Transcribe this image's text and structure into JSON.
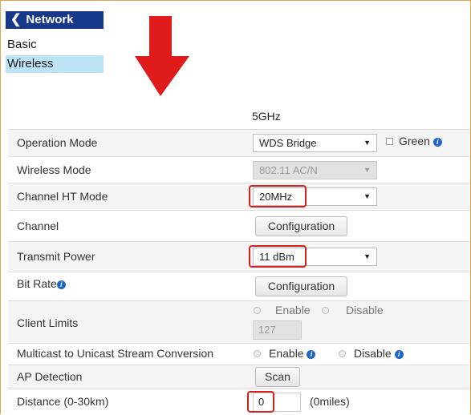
{
  "nav": {
    "title": "Network",
    "items": [
      {
        "label": "Basic"
      },
      {
        "label": "Wireless"
      }
    ]
  },
  "band_label": "5GHz",
  "rows": {
    "operation_mode": {
      "label": "Operation Mode",
      "value": "WDS Bridge",
      "green_label": "Green"
    },
    "wireless_mode": {
      "label": "Wireless Mode",
      "value": "802.11 AC/N"
    },
    "channel_ht_mode": {
      "label": "Channel HT Mode",
      "value": "20MHz"
    },
    "channel": {
      "label": "Channel",
      "button": "Configuration"
    },
    "transmit_power": {
      "label": "Transmit Power",
      "value": "11 dBm"
    },
    "bit_rate": {
      "label": "Bit Rate",
      "button": "Configuration"
    },
    "client_limits": {
      "label": "Client Limits",
      "enable": "Enable",
      "disable": "Disable",
      "value": "127"
    },
    "multicast": {
      "label": "Multicast to Unicast Stream Conversion",
      "enable": "Enable",
      "disable": "Disable"
    },
    "ap_detection": {
      "label": "AP Detection",
      "button": "Scan"
    },
    "distance": {
      "label": "Distance (0-30km)",
      "value": "0",
      "miles": "(0miles)"
    }
  },
  "colors": {
    "nav_bg": "#16378a",
    "selected_bg": "#bde3f7",
    "highlight": "#d62020",
    "arrow": "#e01b1b",
    "info": "#1e66c8"
  }
}
